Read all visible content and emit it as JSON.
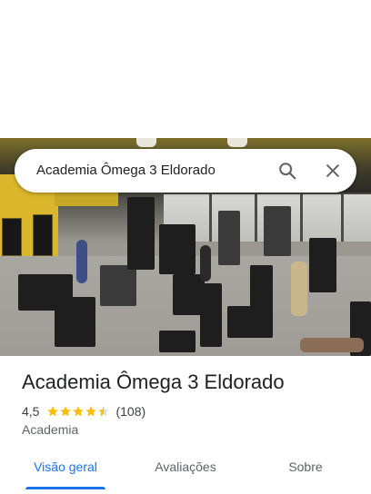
{
  "search": {
    "query": "Academia Ômega 3 Eldorado",
    "search_icon": "search-icon",
    "close_icon": "close-icon"
  },
  "place": {
    "title": "Academia Ômega 3 Eldorado",
    "rating": "4,5",
    "stars_filled": 4.5,
    "review_count": "(108)",
    "category": "Academia"
  },
  "tabs": [
    {
      "label": "Visão geral",
      "active": true
    },
    {
      "label": "Avaliações",
      "active": false
    },
    {
      "label": "Sobre",
      "active": false
    }
  ],
  "colors": {
    "accent": "#1a73e8",
    "star": "#fbbc04",
    "text_primary": "#202124",
    "text_secondary": "#5f6368"
  }
}
